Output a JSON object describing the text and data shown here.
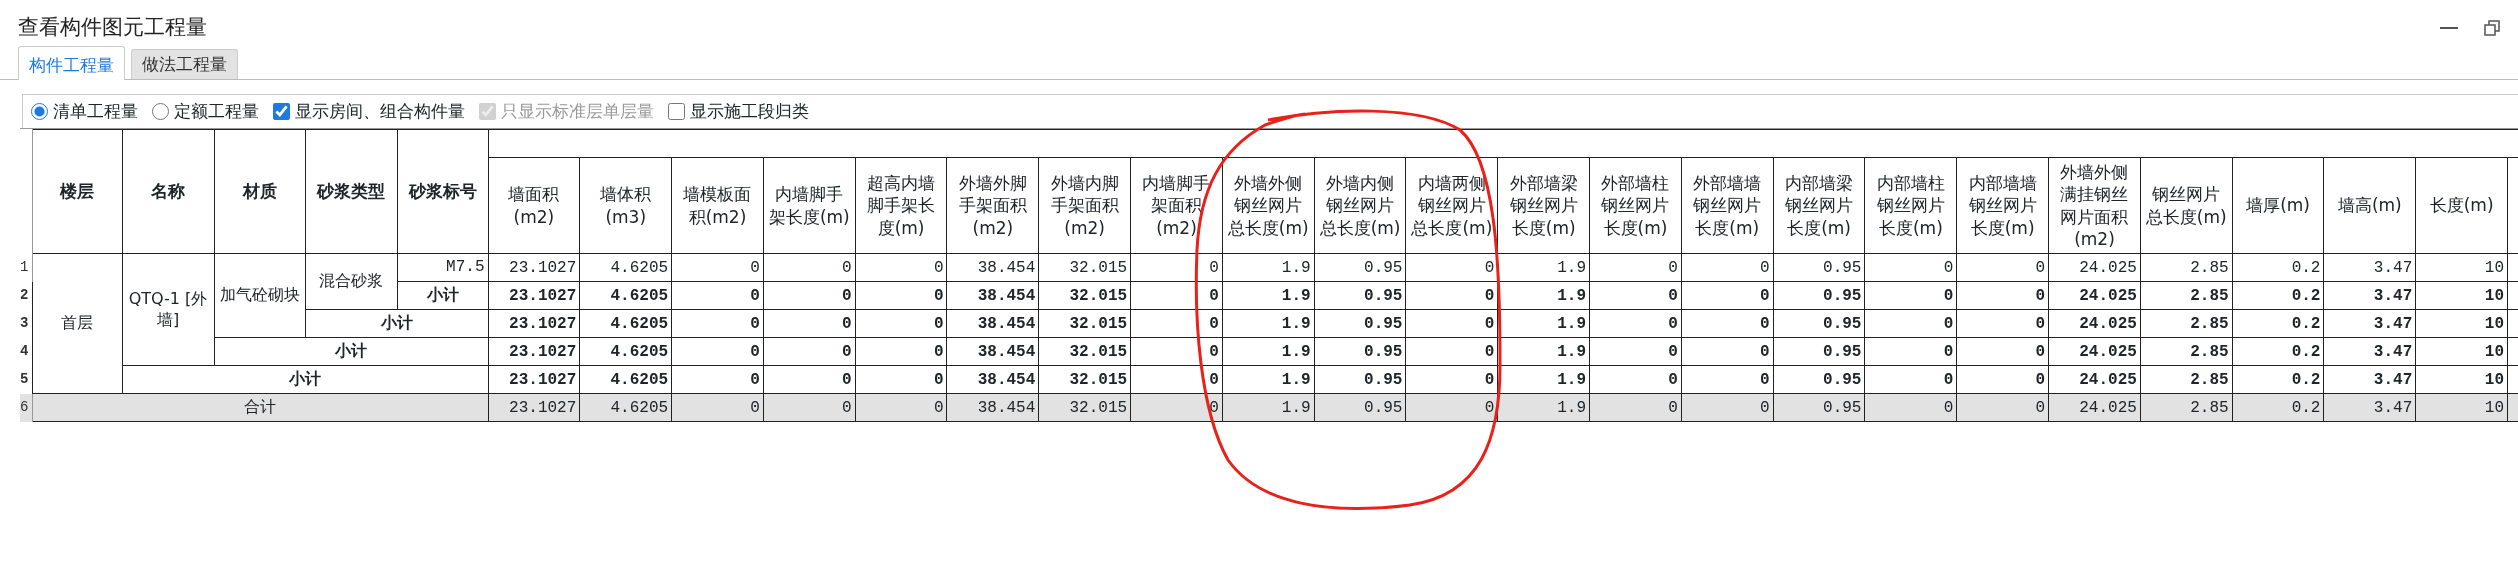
{
  "window": {
    "title": "查看构件图元工程量"
  },
  "tabs": [
    {
      "label": "构件工程量",
      "selected": true
    },
    {
      "label": "做法工程量",
      "selected": false
    }
  ],
  "options": [
    {
      "kind": "radio",
      "label": "清单工程量",
      "checked": true,
      "disabled": false
    },
    {
      "kind": "radio",
      "label": "定额工程量",
      "checked": false,
      "disabled": false
    },
    {
      "kind": "checkbox",
      "label": "显示房间、组合构件量",
      "checked": true,
      "disabled": false
    },
    {
      "kind": "checkbox",
      "label": "只显示标准层单层量",
      "checked": true,
      "disabled": true
    },
    {
      "kind": "checkbox",
      "label": "显示施工段归类",
      "checked": false,
      "disabled": false
    }
  ],
  "table": {
    "label_columns": [
      "楼层",
      "名称",
      "材质",
      "砂浆类型",
      "砂浆标号"
    ],
    "value_columns": [
      "墙面积(m2)",
      "墙体积(m3)",
      "墙模板面积(m2)",
      "内墙脚手架长度(m)",
      "超高内墙脚手架长度(m)",
      "外墙外脚手架面积(m2)",
      "外墙内脚手架面积(m2)",
      "内墙脚手架面积(m2)",
      "外墙外侧钢丝网片总长度(m)",
      "外墙内侧钢丝网片总长度(m)",
      "内墙两侧钢丝网片总长度(m)",
      "外部墙梁钢丝网片长度(m)",
      "外部墙柱钢丝网片长度(m)",
      "外部墙墙钢丝网片长度(m)",
      "内部墙梁钢丝网片长度(m)",
      "内部墙柱钢丝网片长度(m)",
      "内部墙墙钢丝网片长度(m)",
      "外墙外侧满挂钢丝网片面积(m2)",
      "钢丝网片总长度(m)",
      "墙厚(m)",
      "墙高(m)",
      "长度(m)"
    ],
    "row_numbers": [
      "1",
      "2",
      "3",
      "4",
      "5",
      "6"
    ],
    "floors": [
      {
        "name": "首层",
        "children": [
          {
            "name": "QTQ-1 [外墙]",
            "children": [
              {
                "name": "加气砼砌块",
                "children": [
                  {
                    "name": "混合砂浆",
                    "children": [
                      {
                        "name": "M7.5",
                        "values": [
                          "23.1027",
                          "4.6205",
                          "0",
                          "0",
                          "0",
                          "38.454",
                          "32.015",
                          "0",
                          "1.9",
                          "0.95",
                          "0",
                          "1.9",
                          "0",
                          "0",
                          "0.95",
                          "0",
                          "0",
                          "24.025",
                          "2.85",
                          "0.2",
                          "3.47",
                          "10"
                        ]
                      }
                    ],
                    "subtotal": {
                      "label": "小计",
                      "values": [
                        "23.1027",
                        "4.6205",
                        "0",
                        "0",
                        "0",
                        "38.454",
                        "32.015",
                        "0",
                        "1.9",
                        "0.95",
                        "0",
                        "1.9",
                        "0",
                        "0",
                        "0.95",
                        "0",
                        "0",
                        "24.025",
                        "2.85",
                        "0.2",
                        "3.47",
                        "10"
                      ]
                    }
                  }
                ],
                "subtotal": {
                  "label": "小计",
                  "values": [
                    "23.1027",
                    "4.6205",
                    "0",
                    "0",
                    "0",
                    "38.454",
                    "32.015",
                    "0",
                    "1.9",
                    "0.95",
                    "0",
                    "1.9",
                    "0",
                    "0",
                    "0.95",
                    "0",
                    "0",
                    "24.025",
                    "2.85",
                    "0.2",
                    "3.47",
                    "10"
                  ]
                }
              }
            ],
            "subtotal": {
              "label": "小计",
              "values": [
                "23.1027",
                "4.6205",
                "0",
                "0",
                "0",
                "38.454",
                "32.015",
                "0",
                "1.9",
                "0.95",
                "0",
                "1.9",
                "0",
                "0",
                "0.95",
                "0",
                "0",
                "24.025",
                "2.85",
                "0.2",
                "3.47",
                "10"
              ]
            }
          }
        ],
        "subtotal": {
          "label": "小计",
          "values": [
            "23.1027",
            "4.6205",
            "0",
            "0",
            "0",
            "38.454",
            "32.015",
            "0",
            "1.9",
            "0.95",
            "0",
            "1.9",
            "0",
            "0",
            "0.95",
            "0",
            "0",
            "24.025",
            "2.85",
            "0.2",
            "3.47",
            "10"
          ]
        }
      }
    ],
    "total": {
      "label": "合计",
      "values": [
        "23.1027",
        "4.6205",
        "0",
        "0",
        "0",
        "38.454",
        "32.015",
        "0",
        "1.9",
        "0.95",
        "0",
        "1.9",
        "0",
        "0",
        "0.95",
        "0",
        "0",
        "24.025",
        "2.85",
        "0.2",
        "3.47",
        "10"
      ]
    }
  }
}
